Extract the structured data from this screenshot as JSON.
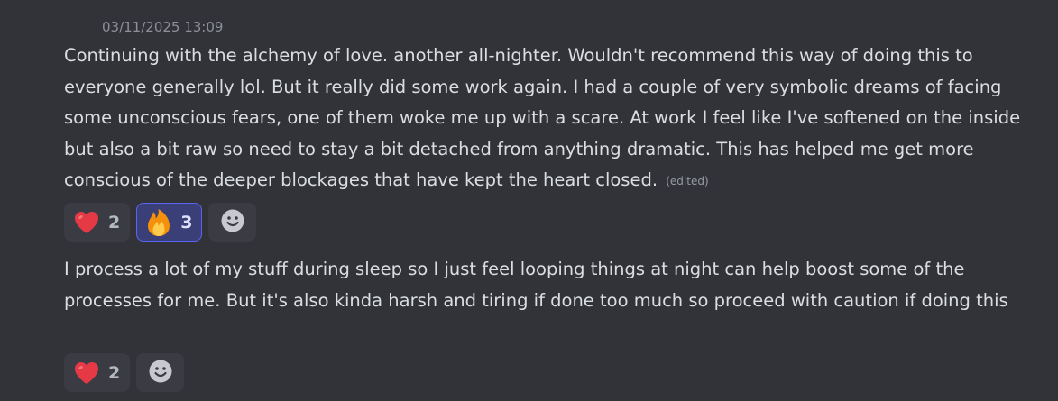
{
  "messages": [
    {
      "timestamp": "03/11/2025 13:09",
      "text": "Continuing with the alchemy of love. another all-nighter. Wouldn't recommend this way of doing this to everyone generally lol. But it really did some work again. I had a couple of very symbolic dreams of facing some unconscious fears, one of them woke me up with a scare. At work I feel like I've softened on the inside but also a bit raw so need to stay a bit detached from anything dramatic. This has helped me get more conscious of the deeper blockages that have kept the heart closed.",
      "edited_label": "(edited)",
      "reactions": [
        {
          "icon": "heart-emoji",
          "count": "2",
          "selected": false
        },
        {
          "icon": "fire-emoji",
          "count": "3",
          "selected": true
        }
      ]
    },
    {
      "text": "I process a lot of my stuff during sleep so I just feel looping things at night can help boost some of the processes for me. But it's also kinda harsh and tiring if done too much so proceed with caution if doing this",
      "reactions": [
        {
          "icon": "heart-emoji",
          "count": "2",
          "selected": false
        }
      ]
    }
  ],
  "colors": {
    "background": "#323339",
    "text": "#dbdee1",
    "muted": "#8e9099",
    "reaction_bg": "#3b3c43",
    "reaction_selected_bg": "#3b3f78",
    "reaction_selected_border": "#5865f2",
    "heart": "#e63946",
    "add_reaction_icon": "#c7c9cf"
  }
}
